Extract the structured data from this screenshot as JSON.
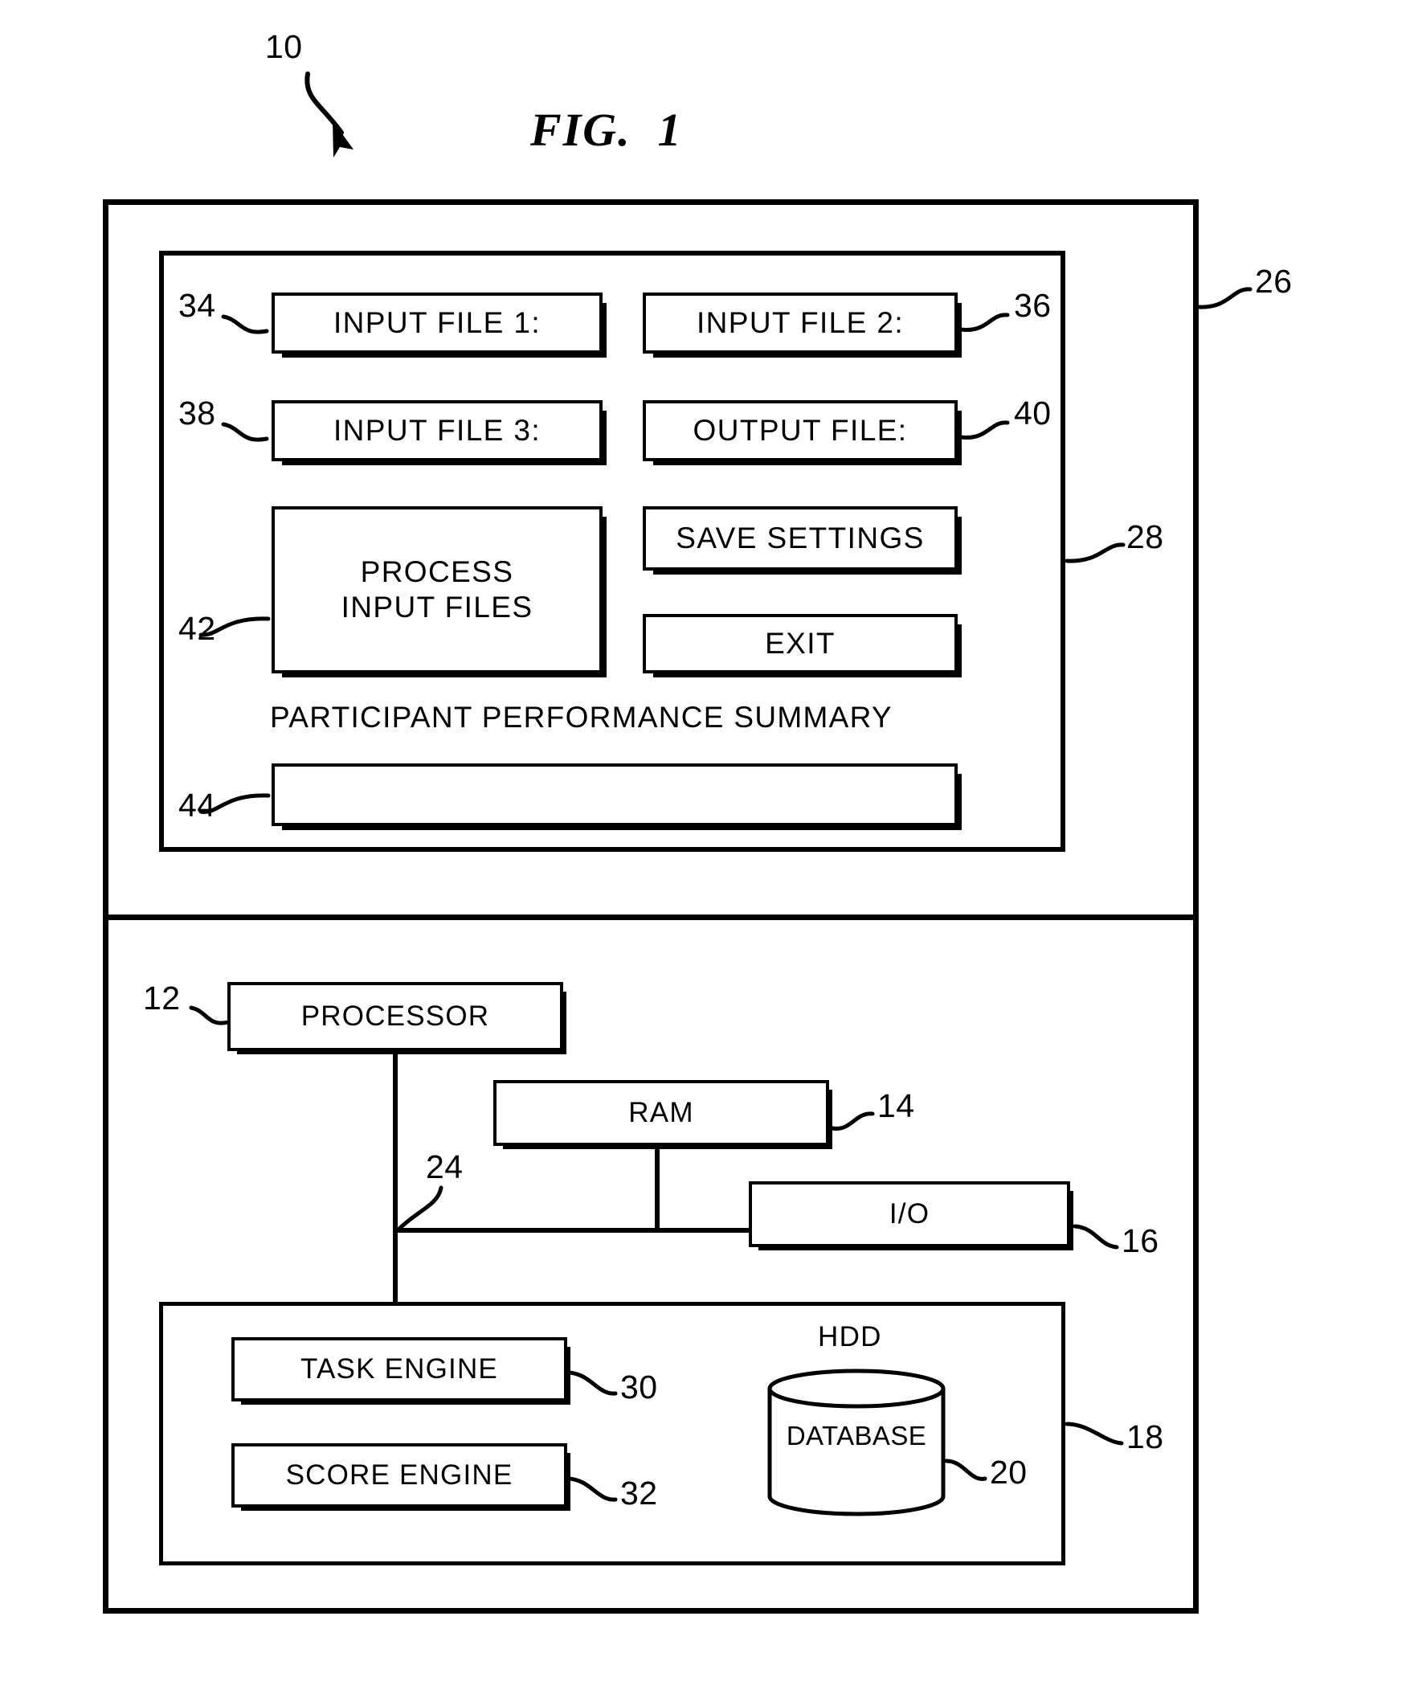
{
  "figure": {
    "title": "FIG.  1",
    "system_ref": "10"
  },
  "refs": {
    "system": "10",
    "processor": "12",
    "ram": "14",
    "io": "16",
    "storage": "18",
    "database": "20",
    "bus": "24",
    "computer": "26",
    "gui": "28",
    "task_engine": "30",
    "score_engine": "32",
    "input_file_1": "34",
    "input_file_2": "36",
    "input_file_3": "38",
    "output_file": "40",
    "process_input_files": "42",
    "summary_field": "44"
  },
  "gui": {
    "buttons": {
      "input_file_1": "INPUT FILE 1:",
      "input_file_2": "INPUT FILE 2:",
      "input_file_3": "INPUT FILE 3:",
      "output_file": "OUTPUT FILE:",
      "process_input_files": "PROCESS\nINPUT FILES",
      "save_settings": "SAVE SETTINGS",
      "exit": "EXIT"
    },
    "summary_heading": "PARTICIPANT PERFORMANCE SUMMARY",
    "summary_value": ""
  },
  "hardware": {
    "processor": "PROCESSOR",
    "ram": "RAM",
    "io": "I/O",
    "hdd_heading": "HDD",
    "database": "DATABASE",
    "task_engine": "TASK ENGINE",
    "score_engine": "SCORE ENGINE"
  },
  "colors": {
    "ink": "#000000",
    "paper": "#ffffff"
  }
}
